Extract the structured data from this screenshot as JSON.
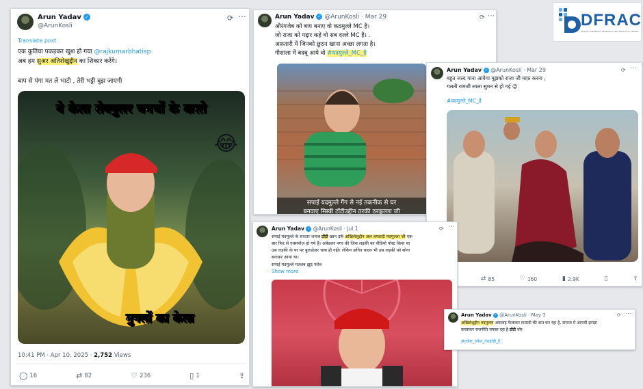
{
  "logo": {
    "text": "DFRAC",
    "tagline": "DIGITAL FORENSICS RESEARCH AND ANALYTICS CENTRE"
  },
  "tweet1": {
    "name": "Arun Yadav",
    "handle": "@ArunKosli",
    "translate": "Translate post",
    "line1a": "एक कुतिया पकड़कर खुश हो गया ",
    "mention": "@rajkumarbhatisp",
    "line2a": "अब हम ",
    "line2hl": "सुअर अतिशेखुद्दीन",
    "line2b": " का शिकार करेंगे।",
    "line3": "बाप से पंगा मत ले भाटी , तेरी भट्टी बुझ जाएगी",
    "img_top": "ये केला सेक्युलर चमचों के वास्ते",
    "img_bottom": "मुगलों का केला",
    "emoji": "😂",
    "time": "10:41 PM · Apr 10, 2025 · ",
    "views_num": "2,752",
    "views_label": " Views",
    "replies": "16",
    "reposts": "82",
    "likes": "236",
    "bookmarks": "1"
  },
  "tweet2": {
    "name": "Arun Yadav",
    "handle": "@ArunKosli · Mar 29",
    "l1": "औरंगजेब को बाप बनाए वो कठमुल्ले MC है।",
    "l2": "जो राजा को गद्दार कहे वो सब दल्ले MC है। .",
    "l3": "अफ़तारी में जिनको छूठन खाना अच्छा लगता है।",
    "l4a": "गौशाला में बदबू आये वो ",
    "l4tag": "#यदमुल्ले_MC_है",
    "caption1": "सपाई यदमुल्ले गैंग से नई तकनीक से घर",
    "caption2": "बनवाए मिस्त्री टोंटीउद्दीन ठरकी ठरकुल्ला जी"
  },
  "tweet3": {
    "name": "Arun Yadav",
    "handle": "@ArunKosli · Mar 29",
    "l1": "बहुत जल्द गाना आयेगा मुझको राजा जी माफ़ करना ,",
    "l2": "गलती रामजी लाला सुमन से हो गई 😜",
    "tag": "#यदमुल्ले_MC_है",
    "replies": "",
    "reposts": "85",
    "likes": "160",
    "views": "2.9K"
  },
  "tweet4": {
    "name": "Arun Yadav",
    "handle": "@ArunKosli · Jul 1",
    "l1a": "सपाई यदमुल्ले के सरदार जनाब ",
    "l1hl": "टोंटी",
    "l1b": " खान उर्फ़ ",
    "l1hl2": "अखिलेशुद्दीन अल बगदादी यदमुल्ला जी",
    "l1c": " एक",
    "l2": "बार फिर से एक्सपोज़ हो गये हैं। अंबेडकर नगर की जिस लड़की का वीडियो पोस्ट किया था",
    "l3": "उस लड़की के पर पर बुलडोज़र चला ही नहीं। लेकिन अनित यादव भी उस लड़की को सोना",
    "l4": "बनाकर आया था।",
    "l5": "सपाई यदमुल्ले मतलब झूठ फरेब",
    "more": "Show more"
  },
  "tweet5": {
    "name": "Arun Yadav",
    "handle": "@ArunKosli · May 3",
    "l1hl": "अखिलेशुद्दीन यदमुल्ला",
    "l1b": " अफ़वाह फैलाकर फ़सादी की बात कर रहा है, समाज में आपसी झगड़ा",
    "l2a": "करवाकर राजनीति चमका रहा है ",
    "l2b": "टोंटी",
    "l2c": " चोर",
    "tag": "#टकेल_ठकेत_देशद्रोही_है"
  },
  "colors": {
    "accent": "#1d9bf0",
    "highlight": "#fff176",
    "logo_blue": "#1e5fa8"
  }
}
